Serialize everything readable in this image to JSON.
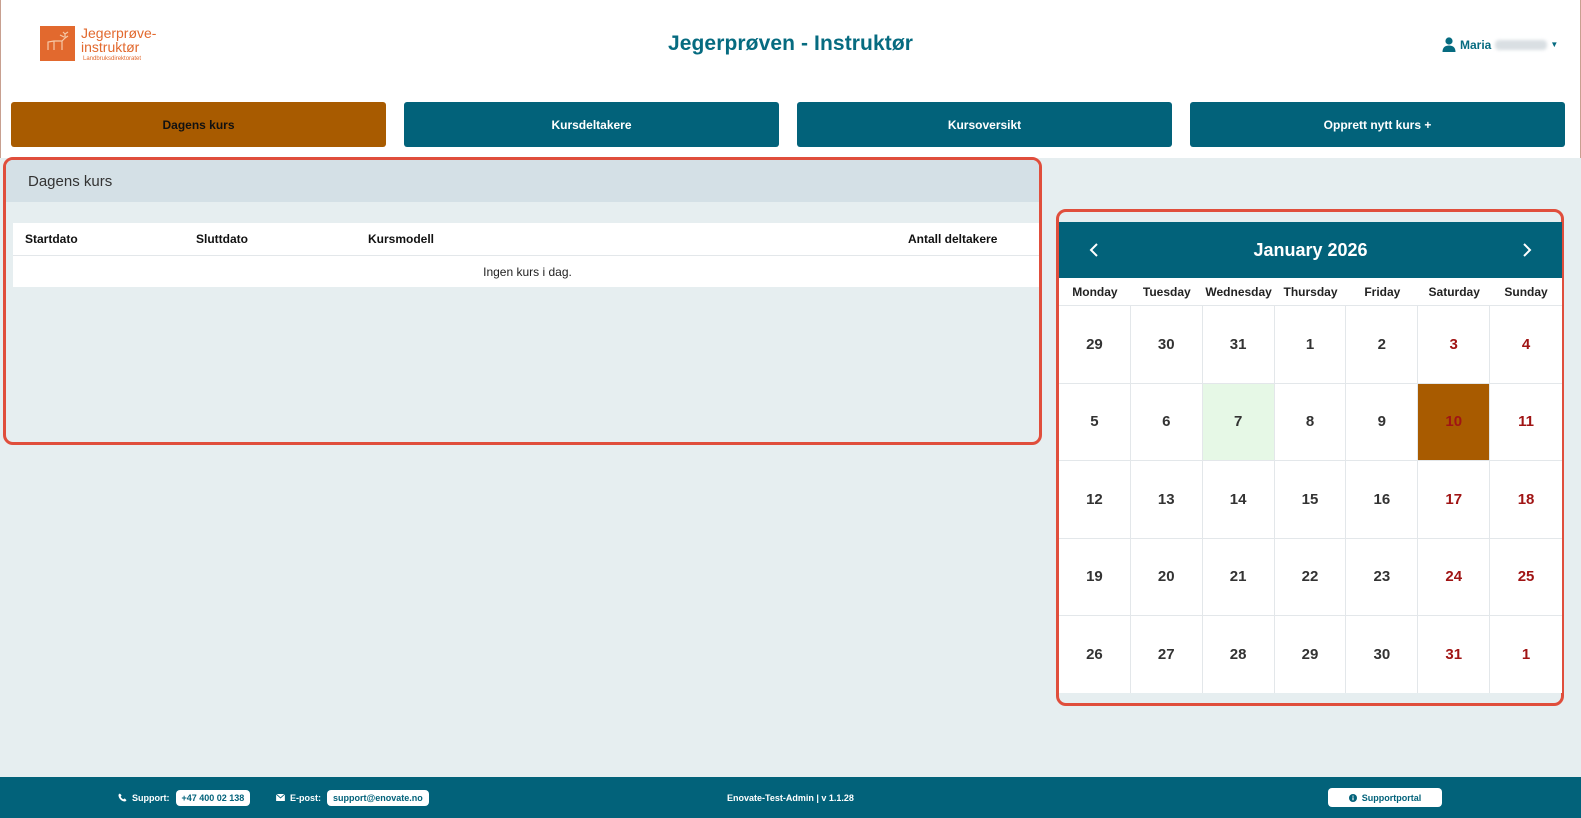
{
  "header": {
    "logo_line1": "Jegerprøve-",
    "logo_line2": "instruktør",
    "logo_sub": "Landbruksdirektoratet",
    "title": "Jegerprøven - Instruktør",
    "user_name": "Maria"
  },
  "nav": [
    {
      "label": "Dagens kurs",
      "active": true
    },
    {
      "label": "Kursdeltakere",
      "active": false
    },
    {
      "label": "Kursoversikt",
      "active": false
    },
    {
      "label": "Opprett nytt kurs +",
      "active": false
    }
  ],
  "course_panel": {
    "title": "Dagens kurs",
    "columns": [
      "Startdato",
      "Sluttdato",
      "Kursmodell",
      "Antall deltakere"
    ],
    "empty_message": "Ingen kurs i dag."
  },
  "calendar": {
    "month_label": "January 2026",
    "weekdays": [
      "Monday",
      "Tuesday",
      "Wednesday",
      "Thursday",
      "Friday",
      "Saturday",
      "Sunday"
    ],
    "weeks": [
      [
        "29",
        "30",
        "31",
        "1",
        "2",
        "3",
        "4"
      ],
      [
        "5",
        "6",
        "7",
        "8",
        "9",
        "10",
        "11"
      ],
      [
        "12",
        "13",
        "14",
        "15",
        "16",
        "17",
        "18"
      ],
      [
        "19",
        "20",
        "21",
        "22",
        "23",
        "24",
        "25"
      ],
      [
        "26",
        "27",
        "28",
        "29",
        "30",
        "31",
        "1"
      ]
    ],
    "today": "7",
    "selected": "10",
    "colors": {
      "weekend": "#a01414",
      "today_bg": "#e6f8e6",
      "selected_bg": "#a85b00"
    }
  },
  "footer": {
    "support_label": "Support:",
    "support_phone": "+47 400 02 138",
    "email_label": "E-post:",
    "email": "support@enovate.no",
    "version": "Enovate-Test-Admin | v 1.1.28",
    "portal_label": "Supportportal"
  },
  "colors": {
    "primary": "#02627a",
    "accent": "#a85b00",
    "logo": "#e2692e",
    "highlight": "#e04e3c"
  }
}
